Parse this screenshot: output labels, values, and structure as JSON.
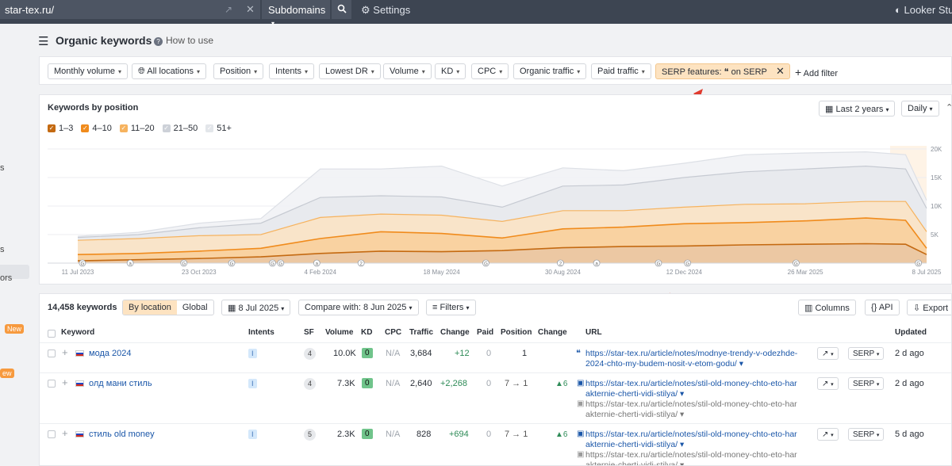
{
  "topbar": {
    "url": "star-tex.ru/",
    "subdomains_label": "Subdomains",
    "settings_label": "Settings",
    "looker_label": "Looker Studio"
  },
  "leftnav": {
    "fragments": [
      "s",
      "s",
      "ors",
      "ew"
    ],
    "new_badge": "New"
  },
  "header": {
    "title": "Organic keywords",
    "how_to": "How to use"
  },
  "filters": [
    "Monthly volume",
    "All locations",
    "Position",
    "Intents",
    "Lowest DR",
    "Volume",
    "KD",
    "CPC",
    "Organic traffic",
    "Paid traffic"
  ],
  "serp_filter": "SERP features: ❝ on SERP",
  "add_filter": "Add filter",
  "chart_card": {
    "title": "Keywords by position",
    "period": "Last 2 years",
    "granularity": "Daily",
    "legend": [
      {
        "label": "1–3",
        "color": "#c46a12"
      },
      {
        "label": "4–10",
        "color": "#f08b1c"
      },
      {
        "label": "11–20",
        "color": "#f6b35f"
      },
      {
        "label": "21–50",
        "color": "#cdd1d8"
      },
      {
        "label": "51+",
        "color": "#e3e6ea"
      }
    ]
  },
  "chart_data": {
    "type": "area",
    "title": "Keywords by position",
    "x": [
      "2023-07-11",
      "2023-09-01",
      "2023-10-23",
      "2023-12-15",
      "2024-02-04",
      "2024-03-27",
      "2024-05-18",
      "2024-07-09",
      "2024-08-30",
      "2024-10-21",
      "2024-12-12",
      "2025-02-02",
      "2025-03-26",
      "2025-05-17",
      "2025-06-20",
      "2025-07-08"
    ],
    "x_tick_labels": [
      "11 Jul 2023",
      "23 Oct 2023",
      "4 Feb 2024",
      "18 May 2024",
      "30 Aug 2024",
      "12 Dec 2024",
      "26 Mar 2025",
      "8 Jul 2025"
    ],
    "y_tick_labels": [
      "20K",
      "15K",
      "10K",
      "5K"
    ],
    "ylim": [
      0,
      20000
    ],
    "series": [
      {
        "name": "1–3",
        "values": [
          400,
          600,
          800,
          1100,
          1700,
          2100,
          2000,
          2200,
          2700,
          2900,
          3000,
          3200,
          3300,
          3400,
          3300,
          1500
        ]
      },
      {
        "name": "4–10",
        "values": [
          1500,
          1700,
          2100,
          2600,
          4300,
          5500,
          5200,
          4400,
          6000,
          6300,
          6900,
          7100,
          7400,
          7900,
          7500,
          2600
        ]
      },
      {
        "name": "11–20",
        "values": [
          4000,
          4300,
          4800,
          5000,
          8000,
          8600,
          8400,
          7300,
          9200,
          9200,
          9800,
          10300,
          10400,
          10800,
          10800,
          5500
        ]
      },
      {
        "name": "21–50",
        "values": [
          4500,
          5000,
          6200,
          7000,
          11500,
          11800,
          11600,
          9800,
          13500,
          13700,
          15000,
          16000,
          16500,
          17000,
          16500,
          9600
        ]
      },
      {
        "name": "51+",
        "values": [
          4700,
          5400,
          7000,
          7800,
          16500,
          16500,
          17000,
          13500,
          16700,
          16200,
          17500,
          19000,
          19300,
          19500,
          19000,
          11000
        ]
      }
    ]
  },
  "table": {
    "count": "14,458 keywords",
    "by_location": "By location",
    "global": "Global",
    "date": "8 Jul 2025",
    "compare": "Compare with: 8 Jun 2025",
    "filters": "Filters",
    "columns_btn": "Columns",
    "api_btn": "API",
    "export_btn": "Export",
    "headers": [
      "Keyword",
      "Intents",
      "SF",
      "Volume",
      "KD",
      "CPC",
      "Traffic",
      "Change",
      "Paid",
      "Position",
      "Change",
      "URL",
      "Updated"
    ],
    "rows": [
      {
        "keyword": "мода 2024",
        "intent": "I",
        "sf": "4",
        "volume": "10.0K",
        "kd": "0",
        "cpc": "N/A",
        "traffic": "3,684",
        "change": "+12",
        "paid": "0",
        "position": "1",
        "pos_change": "",
        "url": "https://star-tex.ru/article/notes/modnye-trendy-v-odezhde-2024-chto-my-budem-nosit-v-etom-godu/ ▾",
        "url2": "",
        "serp": "SERP",
        "updated": "2 d ago"
      },
      {
        "keyword": "олд мани стиль",
        "intent": "I",
        "sf": "4",
        "volume": "7.3K",
        "kd": "0",
        "cpc": "N/A",
        "traffic": "2,640",
        "change": "+2,268",
        "paid": "0",
        "position": "7 → 1",
        "pos_change": "▲6",
        "url": "https://star-tex.ru/article/notes/stil-old-money-chto-eto-harakternie-cherti-vidi-stilya/ ▾",
        "url2": "https://star-tex.ru/article/notes/stil-old-money-chto-eto-harakternie-cherti-vidi-stilya/ ▾",
        "serp": "SERP",
        "updated": "2 d ago"
      },
      {
        "keyword": "стиль old money",
        "intent": "I",
        "sf": "5",
        "volume": "2.3K",
        "kd": "0",
        "cpc": "N/A",
        "traffic": "828",
        "change": "+694",
        "paid": "0",
        "position": "7 → 1",
        "pos_change": "▲6",
        "url": "https://star-tex.ru/article/notes/stil-old-money-chto-eto-harakternie-cherti-vidi-stilya/ ▾",
        "url2": "https://star-tex.ru/article/notes/stil-old-money-chto-eto-harakternie-cherti-vidi-stilya/ ▾",
        "serp": "SERP",
        "updated": "5 d ago"
      }
    ]
  }
}
